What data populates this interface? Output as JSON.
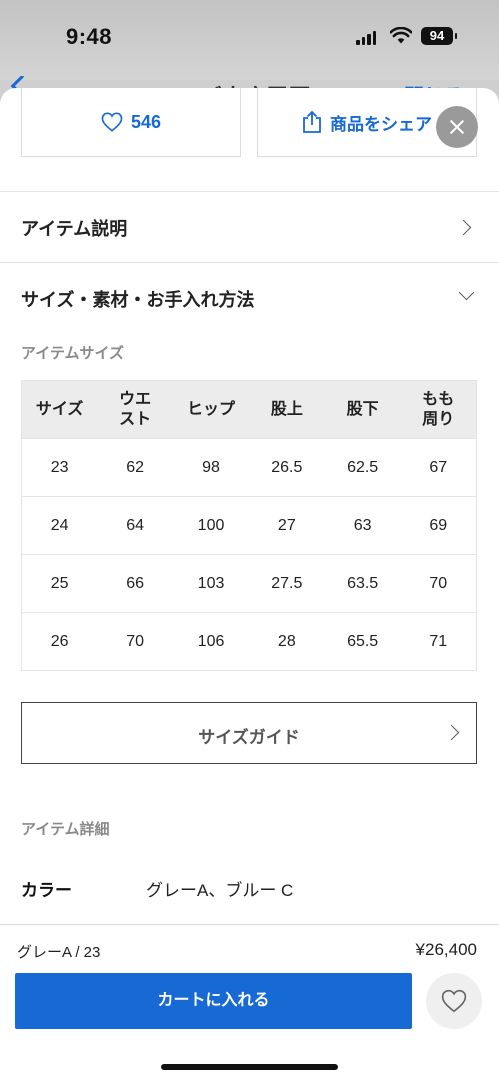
{
  "status_bar": {
    "time": "9:48",
    "battery": "94"
  },
  "background_page": {
    "title": "ご来店履歴",
    "right_action": "閉じる"
  },
  "actions": {
    "like_count": "546",
    "share_label": "商品をシェア"
  },
  "sections": {
    "item_description": "アイテム説明",
    "size_material_care": "サイズ・素材・お手入れ方法"
  },
  "size_table": {
    "title": "アイテムサイズ",
    "headers": [
      "サイズ",
      "ウエスト",
      "ヒップ",
      "股上",
      "股下",
      "もも周り"
    ],
    "rows": [
      [
        "23",
        "62",
        "98",
        "26.5",
        "62.5",
        "67"
      ],
      [
        "24",
        "64",
        "100",
        "27",
        "63",
        "69"
      ],
      [
        "25",
        "66",
        "103",
        "27.5",
        "63.5",
        "70"
      ],
      [
        "26",
        "70",
        "106",
        "28",
        "65.5",
        "71"
      ]
    ]
  },
  "size_guide_label": "サイズガイド",
  "item_details": {
    "title": "アイテム詳細",
    "color_label": "カラー",
    "color_value": "グレーA、ブルー C"
  },
  "purchase": {
    "selected_variant": "グレーA / 23",
    "price": "¥26,400",
    "add_to_cart": "カートに入れる"
  },
  "colors": {
    "accent": "#1769d4"
  }
}
